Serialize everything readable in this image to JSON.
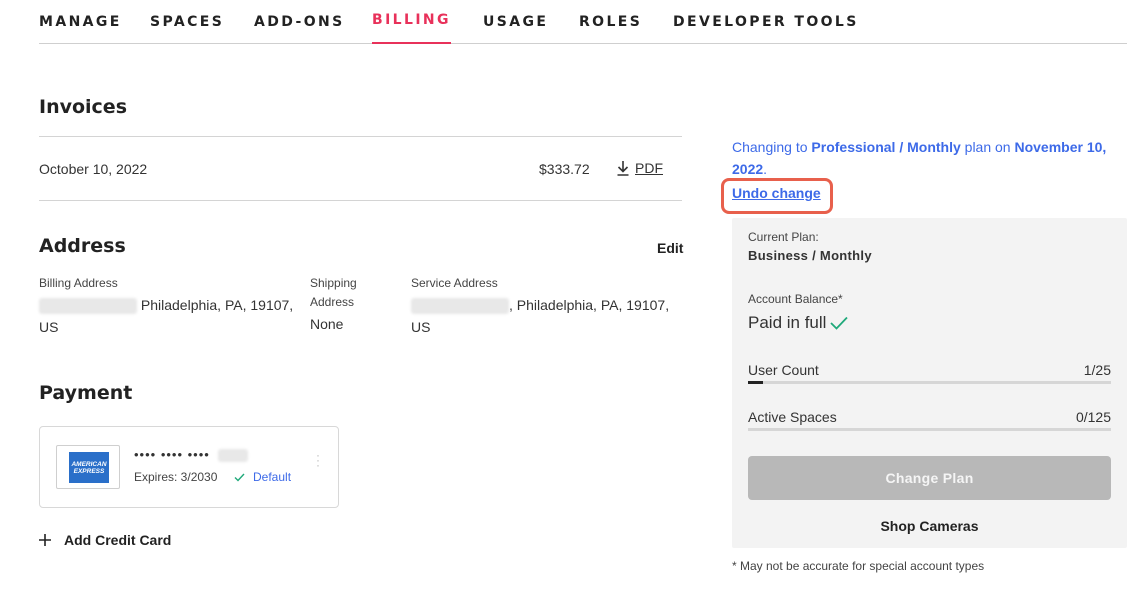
{
  "nav": {
    "tabs": [
      {
        "label": "MANAGE"
      },
      {
        "label": "SPACES"
      },
      {
        "label": "ADD-ONS"
      },
      {
        "label": "BILLING"
      },
      {
        "label": "USAGE"
      },
      {
        "label": "ROLES"
      },
      {
        "label": "DEVELOPER TOOLS"
      }
    ],
    "active": "BILLING"
  },
  "invoices": {
    "title": "Invoices",
    "rows": [
      {
        "date": "October 10, 2022",
        "amount": "$333.72",
        "pdf_label": "PDF"
      }
    ]
  },
  "address": {
    "title": "Address",
    "edit_label": "Edit",
    "billing": {
      "label": "Billing Address",
      "value": "Philadelphia, PA, 19107,",
      "country": "US"
    },
    "shipping": {
      "label_line1": "Shipping",
      "label_line2": "Address",
      "value": "None"
    },
    "service": {
      "label": "Service Address",
      "value": ", Philadelphia, PA, 19107,",
      "country": "US"
    }
  },
  "payment": {
    "title": "Payment",
    "card": {
      "brand_line1": "AMERICAN",
      "brand_line2": "EXPRESS",
      "masked": "•••• •••• ••••",
      "expires": "Expires: 3/2030",
      "default_label": "Default"
    },
    "add_label": "Add Credit Card"
  },
  "plan_change": {
    "prefix": "Changing to ",
    "plan": "Professional / Monthly",
    "middle": " plan on ",
    "date": "November 10, 2022",
    "suffix": ".",
    "undo_label": "Undo change"
  },
  "summary": {
    "current_plan_label": "Current Plan:",
    "current_plan": "Business / Monthly",
    "balance_label": "Account Balance*",
    "balance_value": "Paid in full",
    "user_count_label": "User Count",
    "user_count_value": "1/25",
    "user_count_fraction": 0.04,
    "active_spaces_label": "Active Spaces",
    "active_spaces_value": "0/125",
    "active_spaces_fraction": 0,
    "change_plan_label": "Change Plan",
    "shop_label": "Shop Cameras"
  },
  "footnote": "* May not be accurate for special account types",
  "colors": {
    "accent": "#e8315a",
    "link": "#3d6ae8",
    "success": "#1fa97a",
    "highlight": "#e8604c"
  }
}
